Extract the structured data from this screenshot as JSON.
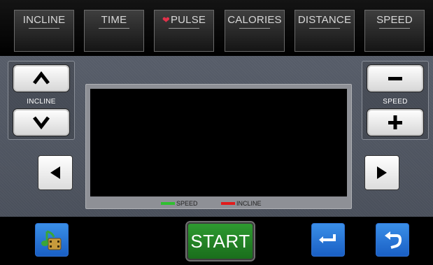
{
  "metrics": [
    {
      "label": "INCLINE"
    },
    {
      "label": "TIME"
    },
    {
      "label": "PULSE",
      "icon": "heart-icon"
    },
    {
      "label": "CALORIES"
    },
    {
      "label": "DISTANCE"
    },
    {
      "label": "SPEED"
    }
  ],
  "incline_group": {
    "label": "INCLINE",
    "up_icon": "chevron-up-icon",
    "down_icon": "chevron-down-icon"
  },
  "speed_group": {
    "label": "SPEED",
    "minus_icon": "minus-icon",
    "plus_icon": "plus-icon"
  },
  "nav": {
    "left_icon": "triangle-left-icon",
    "right_icon": "triangle-right-icon"
  },
  "display": {
    "legend": [
      {
        "label": "SPEED",
        "color": "#2fbf2f"
      },
      {
        "label": "INCLINE",
        "color": "#e11b1b"
      }
    ]
  },
  "bottom": {
    "start_label": "START",
    "media_icon": "music-video-icon",
    "enter_icon": "enter-return-icon",
    "back_icon": "back-arrow-icon"
  },
  "colors": {
    "start": "#1f7d21",
    "blue_button": "#2a7be0",
    "panel": "#535965"
  }
}
